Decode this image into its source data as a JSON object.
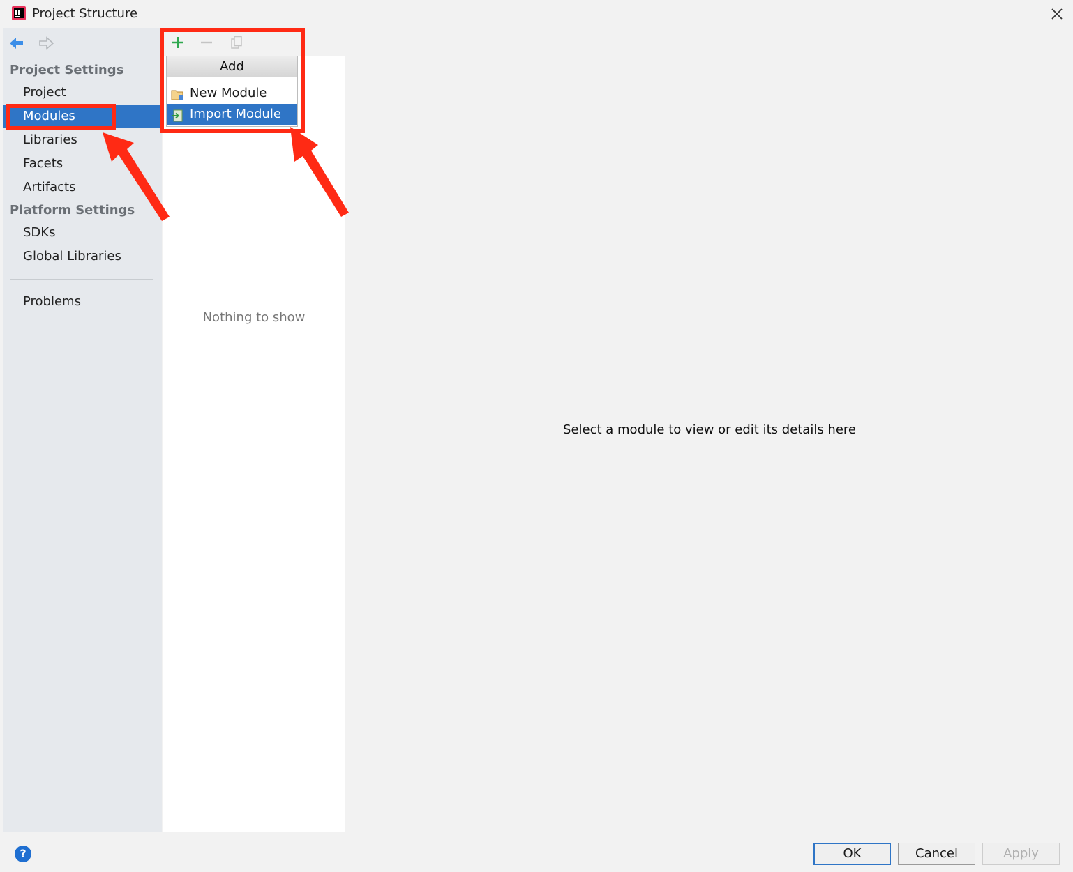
{
  "window": {
    "title": "Project Structure",
    "icons": {
      "app": "intellij-app-icon",
      "close": "close-icon"
    }
  },
  "sidebar": {
    "sections": [
      {
        "header": "Project Settings",
        "items": [
          "Project",
          "Modules",
          "Libraries",
          "Facets",
          "Artifacts"
        ]
      },
      {
        "header": "Platform Settings",
        "items": [
          "SDKs",
          "Global Libraries"
        ]
      }
    ],
    "problems": "Problems",
    "selected": "Modules"
  },
  "module_panel": {
    "empty_text": "Nothing to show",
    "toolbar_icons": [
      "plus-icon",
      "minus-icon",
      "copy-icon"
    ]
  },
  "add_popup": {
    "title": "Add",
    "items": [
      "New Module",
      "Import Module"
    ],
    "highlighted": "Import Module"
  },
  "details": {
    "placeholder": "Select a module to view or edit its details here"
  },
  "footer": {
    "help": "?",
    "ok": "OK",
    "cancel": "Cancel",
    "apply": "Apply"
  },
  "colors": {
    "selection": "#2f75c6",
    "annotation": "#ff2a14",
    "sidebar_bg": "#e6e9ed"
  }
}
